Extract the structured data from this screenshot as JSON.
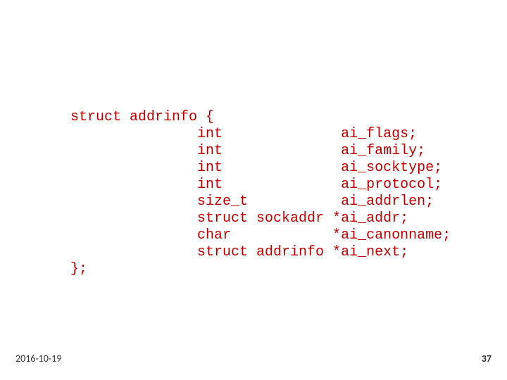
{
  "code": {
    "line1": "struct addrinfo {",
    "line2": "               int              ai_flags;",
    "line3": "               int              ai_family;",
    "line4": "               int              ai_socktype;",
    "line5": "               int              ai_protocol;",
    "line6": "               size_t           ai_addrlen;",
    "line7": "               struct sockaddr *ai_addr;",
    "line8": "               char            *ai_canonname;",
    "line9": "               struct addrinfo *ai_next;",
    "line10": "};"
  },
  "footer": {
    "date": "2016-10-19",
    "page": "37"
  },
  "colors": {
    "code": "#c00000",
    "background": "#ffffff"
  }
}
